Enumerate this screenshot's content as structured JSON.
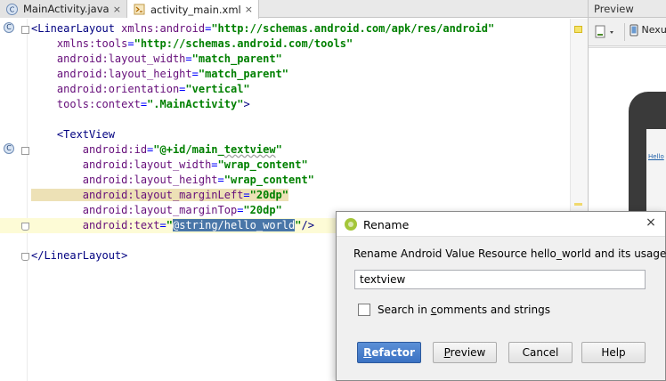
{
  "tabs": [
    {
      "icon": "java-class-icon",
      "icon_letter": "C",
      "label": "MainActivity.java",
      "close": "×"
    },
    {
      "icon": "xml-file-icon",
      "label": "activity_main.xml",
      "close": "×"
    }
  ],
  "code": {
    "lines": [
      {
        "parts": [
          [
            "tag",
            "<LinearLayout "
          ],
          [
            "attr-ns",
            "xmlns:android"
          ],
          [
            "attr",
            "="
          ],
          [
            "val",
            "\"http://schemas.android.com/apk/res/android\""
          ]
        ]
      },
      {
        "parts": [
          [
            "attr-ns",
            "    xmlns:tools"
          ],
          [
            "attr",
            "="
          ],
          [
            "val",
            "\"http://schemas.android.com/tools\""
          ]
        ]
      },
      {
        "parts": [
          [
            "attr-ns",
            "    android:layout_width"
          ],
          [
            "attr",
            "="
          ],
          [
            "val",
            "\"match_parent\""
          ]
        ]
      },
      {
        "parts": [
          [
            "attr-ns",
            "    android:layout_height"
          ],
          [
            "attr",
            "="
          ],
          [
            "val",
            "\"match_parent\""
          ]
        ]
      },
      {
        "parts": [
          [
            "attr-ns",
            "    android:orientation"
          ],
          [
            "attr",
            "="
          ],
          [
            "val",
            "\"vertical\""
          ]
        ]
      },
      {
        "parts": [
          [
            "attr-ns",
            "    tools:context"
          ],
          [
            "attr",
            "="
          ],
          [
            "val",
            "\".MainActivity\""
          ],
          [
            "tag",
            ">"
          ]
        ]
      },
      {
        "parts": []
      },
      {
        "parts": [
          [
            "tag",
            "    <TextView"
          ]
        ]
      },
      {
        "parts": [
          [
            "attr-ns",
            "        android:id"
          ],
          [
            "attr",
            "="
          ],
          [
            "val",
            "\"@+id/main_"
          ],
          [
            "val squig",
            "textview"
          ],
          [
            "val",
            "\""
          ]
        ]
      },
      {
        "parts": [
          [
            "attr-ns",
            "        android:layout_width"
          ],
          [
            "attr",
            "="
          ],
          [
            "val",
            "\"wrap_content\""
          ]
        ]
      },
      {
        "parts": [
          [
            "attr-ns",
            "        android:layout_height"
          ],
          [
            "attr",
            "="
          ],
          [
            "val",
            "\"wrap_content\""
          ]
        ]
      },
      {
        "parts": [
          [
            "attr-ns hl-attr",
            "        android:layout_marginLeft"
          ],
          [
            "attr hl-attr",
            "="
          ],
          [
            "val hl-attr",
            "\"20dp\""
          ]
        ]
      },
      {
        "parts": [
          [
            "attr-ns",
            "        android:layout_marginTop"
          ],
          [
            "attr",
            "="
          ],
          [
            "val",
            "\"20dp\""
          ]
        ]
      },
      {
        "parts": [
          [
            "attr-ns",
            "        android:text"
          ],
          [
            "attr",
            "="
          ],
          [
            "val",
            "\""
          ],
          [
            "sel",
            "@string/hello_world"
          ],
          [
            "val",
            "\""
          ],
          [
            "tag",
            "/>"
          ]
        ],
        "current": true
      },
      {
        "parts": []
      },
      {
        "parts": [
          [
            "tag",
            "</LinearLayout>"
          ]
        ]
      }
    ]
  },
  "preview": {
    "title": "Preview",
    "device_label": "Nexus",
    "phone_text": "Hello"
  },
  "dialog": {
    "title": "Rename",
    "close": "×",
    "message": "Rename Android Value Resource hello_world and its usages to:",
    "input_value": "textview",
    "checkbox_label_pre": "Search in ",
    "checkbox_label_ul": "c",
    "checkbox_label_post": "omments and strings",
    "checkbox_checked": false,
    "buttons": {
      "refactor_ul": "R",
      "refactor_rest": "efactor",
      "preview_ul": "P",
      "preview_rest": "review",
      "cancel": "Cancel",
      "help": "Help"
    }
  }
}
